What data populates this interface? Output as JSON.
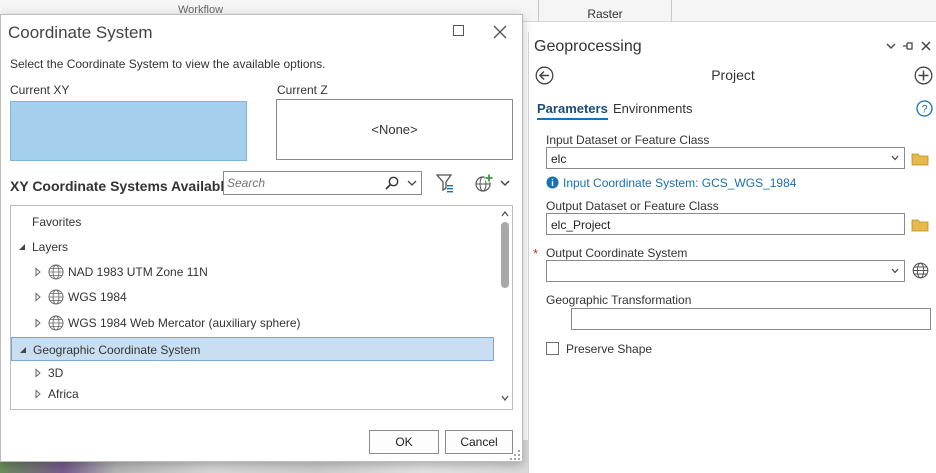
{
  "background": {
    "ribbon_tab": "Raster",
    "ribbon_hint": "Workflow"
  },
  "dialog": {
    "title": "Coordinate System",
    "instructions": "Select the Coordinate System to view the available options.",
    "current_xy_label": "Current XY",
    "current_z_label": "Current Z",
    "current_xy_value": "",
    "current_z_value": "<None>",
    "available_title": "XY Coordinate Systems Available",
    "search": {
      "placeholder": "Search",
      "value": ""
    },
    "tree": [
      {
        "label": "Favorites",
        "level": 0,
        "expander": "none",
        "globe": false,
        "selected": false
      },
      {
        "label": "Layers",
        "level": 0,
        "expander": "expanded",
        "globe": false,
        "selected": false
      },
      {
        "label": "NAD 1983 UTM Zone 11N",
        "level": 1,
        "expander": "collapsed",
        "globe": true,
        "selected": false
      },
      {
        "label": "WGS 1984",
        "level": 1,
        "expander": "collapsed",
        "globe": true,
        "selected": false
      },
      {
        "label": "WGS 1984 Web Mercator (auxiliary sphere)",
        "level": 1,
        "expander": "collapsed",
        "globe": true,
        "selected": false
      },
      {
        "label": "Geographic Coordinate System",
        "level": 0,
        "expander": "expanded",
        "globe": false,
        "selected": true
      },
      {
        "label": "3D",
        "level": 1,
        "expander": "collapsed",
        "globe": false,
        "selected": false
      },
      {
        "label": "Africa",
        "level": 1,
        "expander": "collapsed",
        "globe": false,
        "selected": false
      }
    ],
    "ok_label": "OK",
    "cancel_label": "Cancel"
  },
  "geoprocessing": {
    "pane_title": "Geoprocessing",
    "tool_name": "Project",
    "tabs": [
      {
        "label": "Parameters",
        "active": true
      },
      {
        "label": "Environments",
        "active": false
      }
    ],
    "input_label": "Input Dataset or Feature Class",
    "input_value": "elc",
    "input_cs_info": "Input Coordinate System: GCS_WGS_1984",
    "output_label": "Output Dataset or Feature Class",
    "output_value": "elc_Project",
    "required_marker": "*",
    "out_cs_label": "Output Coordinate System",
    "out_cs_value": "",
    "geo_transform_label": "Geographic Transformation",
    "geo_transform_value": "",
    "preserve_shape_label": "Preserve Shape",
    "preserve_shape_checked": false
  },
  "colors": {
    "accent": "#1a6fb5",
    "selection_fill": "#c9dff1",
    "current_xy_fill": "#a4d0ee",
    "folder": "#e8b84a",
    "required": "#c0392b"
  }
}
